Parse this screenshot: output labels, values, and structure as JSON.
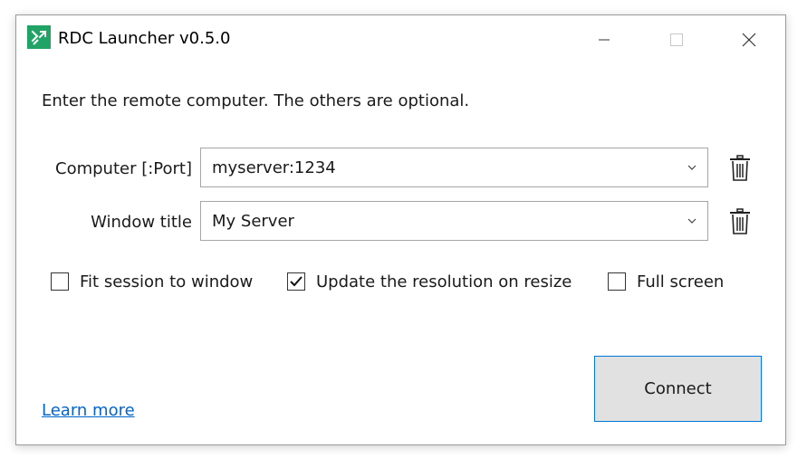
{
  "window": {
    "title": "RDC Launcher v0.5.0",
    "icon": "remote-desktop-icon",
    "controls": [
      "minimize-icon",
      "maximize-icon",
      "close-icon"
    ]
  },
  "instruction": "Enter the remote computer. The others are optional.",
  "fields": {
    "computer": {
      "label": "Computer [:Port]",
      "value": "myserver:1234"
    },
    "window_title": {
      "label": "Window title",
      "value": "My Server"
    }
  },
  "options": {
    "fit_session": {
      "label": "Fit session to window",
      "checked": false
    },
    "update_resolution": {
      "label": "Update the resolution on resize",
      "checked": true
    },
    "full_screen": {
      "label": "Full screen",
      "checked": false
    }
  },
  "learn_more": "Learn more",
  "connect": "Connect",
  "colors": {
    "accent": "#0078d7",
    "link": "#0066cc",
    "icon_bg": "#21a366"
  }
}
